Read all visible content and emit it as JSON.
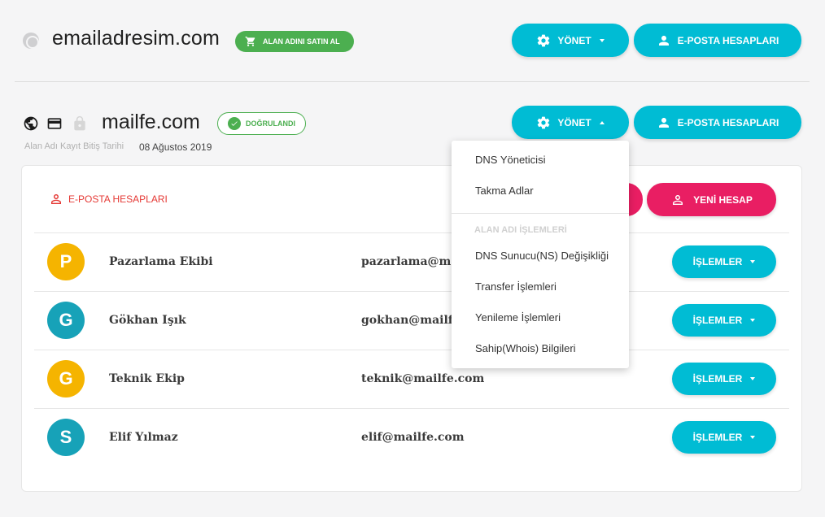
{
  "domain1": {
    "name": "emailadresim.com",
    "buy_badge": "ALAN ADINI SATIN AL",
    "manage_label": "YÖNET",
    "accounts_label": "E-POSTA HESAPLARI"
  },
  "domain2": {
    "name": "mailfe.com",
    "verified_label": "DOĞRULANDI",
    "expiry_label": "Alan Adı Kayıt Bitiş Tarihi",
    "expiry_date": "08 Ağustos 2019",
    "manage_label": "YÖNET",
    "accounts_label": "E-POSTA HESAPLARI"
  },
  "card": {
    "title": "E-POSTA HESAPLARI",
    "new_account_label": "YENİ HESAP",
    "ops_label": "İŞLEMLER",
    "rows": [
      {
        "initial": "P",
        "color": "#f5b400",
        "name": "Pazarlama Ekibi",
        "email": "pazarlama@mailfe.com"
      },
      {
        "initial": "G",
        "color": "#17a2b8",
        "name": "Gökhan Işık",
        "email": "gokhan@mailfe.com"
      },
      {
        "initial": "G",
        "color": "#f5b400",
        "name": "Teknik Ekip",
        "email": "teknik@mailfe.com"
      },
      {
        "initial": "S",
        "color": "#17a2b8",
        "name": "Elif Yılmaz",
        "email": "elif@mailfe.com"
      }
    ]
  },
  "dropdown": {
    "items_top": [
      "DNS Yöneticisi",
      "Takma Adlar"
    ],
    "section_header": "ALAN ADI İŞLEMLERİ",
    "items_bottom": [
      "DNS Sunucu(NS) Değişikliği",
      "Transfer İşlemleri",
      "Yenileme İşlemleri",
      "Sahip(Whois) Bilgileri"
    ]
  },
  "colors": {
    "accent": "#00bcd4",
    "success": "#4caf50",
    "danger": "#e53935",
    "pink": "#e91e63"
  }
}
